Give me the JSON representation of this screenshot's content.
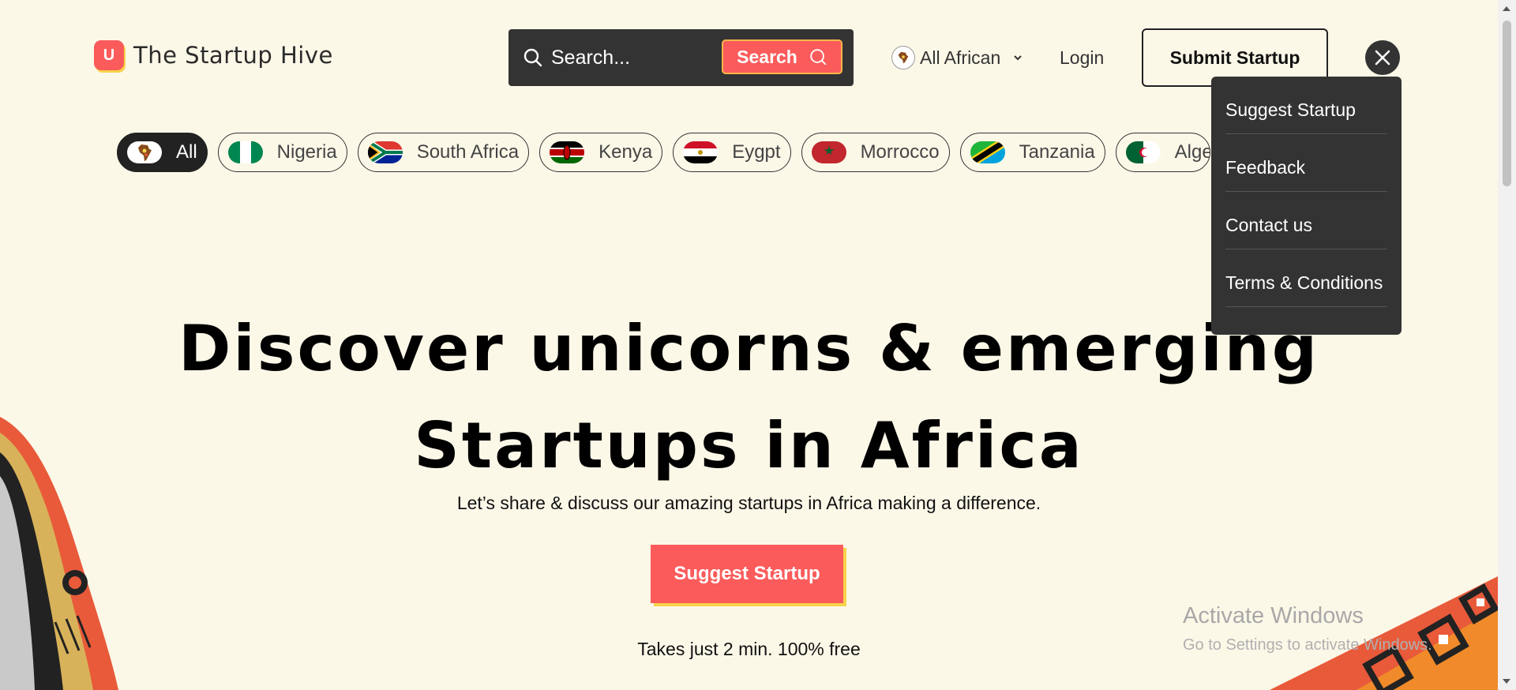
{
  "header": {
    "logo_letter": "U",
    "brand_name": "The Startup Hive",
    "search_placeholder": "Search...",
    "search_button": "Search",
    "region_label": "All African",
    "login_label": "Login",
    "submit_label": "Submit Startup"
  },
  "countries": [
    {
      "label": "All",
      "icon": "africa-icon",
      "active": true
    },
    {
      "label": "Nigeria",
      "icon": "nigeria-flag-icon"
    },
    {
      "label": "South Africa",
      "icon": "south-africa-flag-icon"
    },
    {
      "label": "Kenya",
      "icon": "kenya-flag-icon"
    },
    {
      "label": "Eygpt",
      "icon": "egypt-flag-icon"
    },
    {
      "label": "Morrocco",
      "icon": "morocco-flag-icon"
    },
    {
      "label": "Tanzania",
      "icon": "tanzania-flag-icon"
    },
    {
      "label": "Alge",
      "icon": "algeria-flag-icon"
    }
  ],
  "menu": {
    "items": [
      "Suggest Startup",
      "Feedback",
      "Contact us",
      "Terms & Conditions"
    ]
  },
  "hero": {
    "line1": "Discover unicorns & emerging",
    "line2": "Startups in Africa",
    "subtitle": "Let’s share & discuss our amazing startups in Africa making a difference.",
    "cta": "Suggest Startup",
    "note": "Takes just 2 min. 100% free"
  },
  "watermark": {
    "title": "Activate Windows",
    "subtitle": "Go to Settings to activate Windows."
  },
  "colors": {
    "background": "#fcf8e8",
    "accent": "#fb5b5b",
    "accent_shadow": "#f7d34a",
    "dark": "#333333"
  }
}
